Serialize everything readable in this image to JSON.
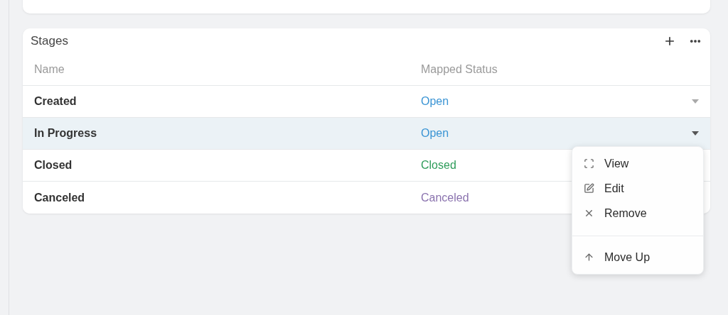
{
  "card": {
    "title": "Stages",
    "columns": [
      "Name",
      "Mapped Status"
    ],
    "rows": [
      {
        "name": "Created",
        "status": "Open",
        "color": "#3a94d4",
        "selected": false,
        "menu_open": false
      },
      {
        "name": "In Progress",
        "status": "Open",
        "color": "#3a94d4",
        "selected": true,
        "menu_open": true
      },
      {
        "name": "Closed",
        "status": "Closed",
        "color": "#2e9c5a",
        "selected": false,
        "menu_open": false
      },
      {
        "name": "Canceled",
        "status": "Canceled",
        "color": "#8a72ae",
        "selected": false,
        "menu_open": false
      }
    ]
  },
  "menu": {
    "sections": [
      [
        {
          "label": "View",
          "kind": "view"
        },
        {
          "label": "Edit",
          "kind": "edit"
        },
        {
          "label": "Remove",
          "kind": "remove"
        }
      ],
      [
        {
          "label": "Move Up",
          "kind": "move_up"
        }
      ]
    ]
  }
}
